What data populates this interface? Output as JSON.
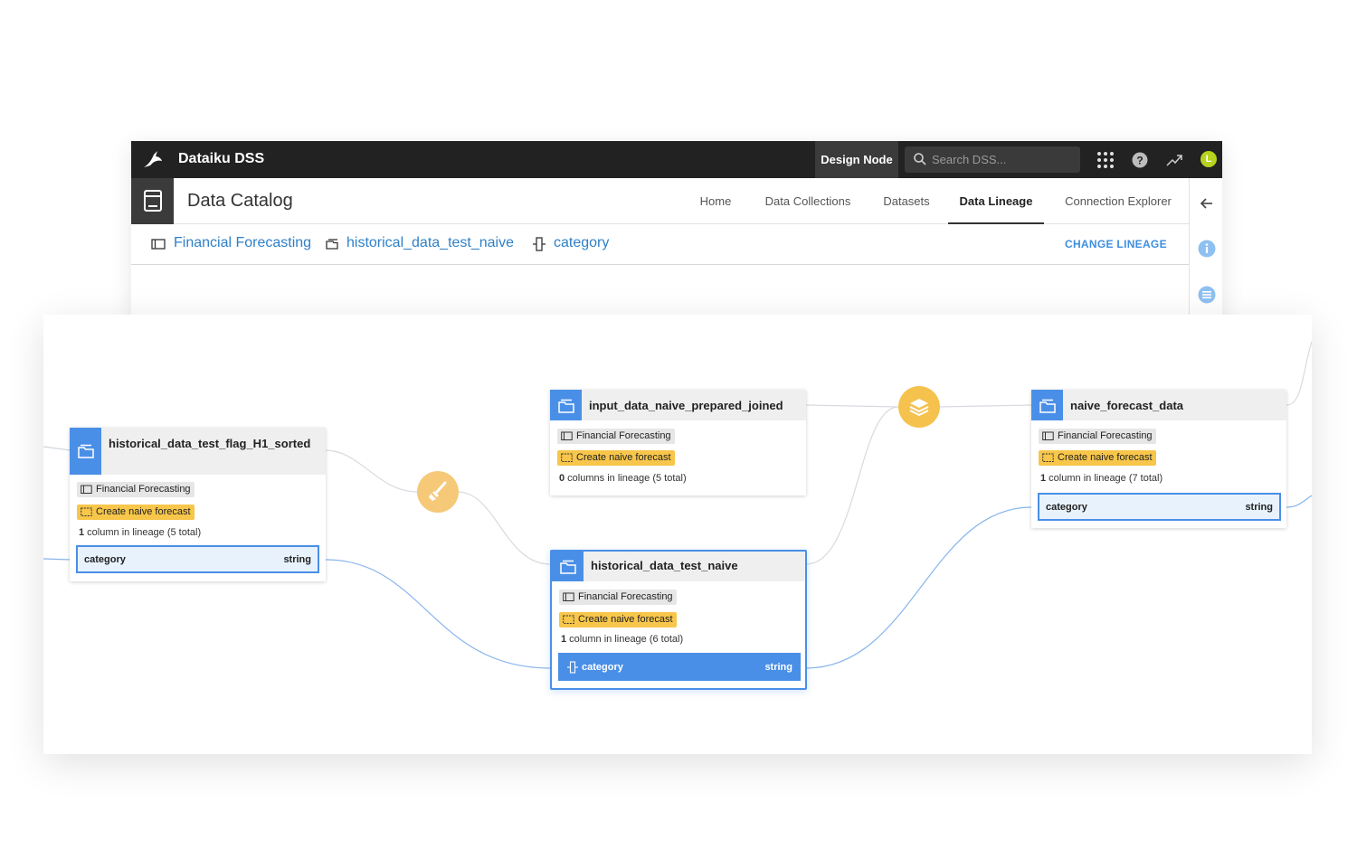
{
  "app": {
    "brand_name": "Dataiku DSS",
    "node_label": "Design Node",
    "search_placeholder": "Search DSS...",
    "avatar_initial": "L",
    "avatar_color": "#b7d31e"
  },
  "header": {
    "title": "Data Catalog",
    "nav": [
      {
        "label": "Home",
        "active": false
      },
      {
        "label": "Data Collections",
        "active": false
      },
      {
        "label": "Datasets",
        "active": false
      },
      {
        "label": "Data Lineage",
        "active": true
      },
      {
        "label": "Connection Explorer",
        "active": false
      }
    ]
  },
  "breadcrumb": {
    "project": "Financial Forecasting",
    "dataset": "historical_data_test_naive",
    "column": "category",
    "action": "CHANGE LINEAGE"
  },
  "colors": {
    "accent_blue": "#4a8fe7",
    "link_blue": "#2f80c8",
    "recipe_yellow": "#f5c24e",
    "topbar": "#222222"
  },
  "lineage": {
    "nodes": [
      {
        "id": "sorted",
        "title": "historical_data_test_flag_H1_sorted",
        "project_tag": "Financial Forecasting",
        "flow_tag": "Create naive forecast",
        "count_num": "1",
        "count_text": " column in lineage (5 total)",
        "column": {
          "name": "category",
          "type": "string"
        }
      },
      {
        "id": "joined",
        "title": "input_data_naive_prepared_joined",
        "project_tag": "Financial Forecasting",
        "flow_tag": "Create naive forecast",
        "count_num": "0",
        "count_text": " columns in lineage (5 total)"
      },
      {
        "id": "naive",
        "title": "historical_data_test_naive",
        "project_tag": "Financial Forecasting",
        "flow_tag": "Create naive forecast",
        "count_num": "1",
        "count_text": " column in lineage (6 total)",
        "column": {
          "name": "category",
          "type": "string"
        }
      },
      {
        "id": "forecast",
        "title": "naive_forecast_data",
        "project_tag": "Financial Forecasting",
        "flow_tag": "Create naive forecast",
        "count_num": "1",
        "count_text": " column in lineage (7 total)",
        "column": {
          "name": "category",
          "type": "string"
        }
      }
    ],
    "recipes": [
      {
        "icon": "prepare-brush-icon"
      },
      {
        "icon": "stack-layers-icon"
      }
    ]
  }
}
